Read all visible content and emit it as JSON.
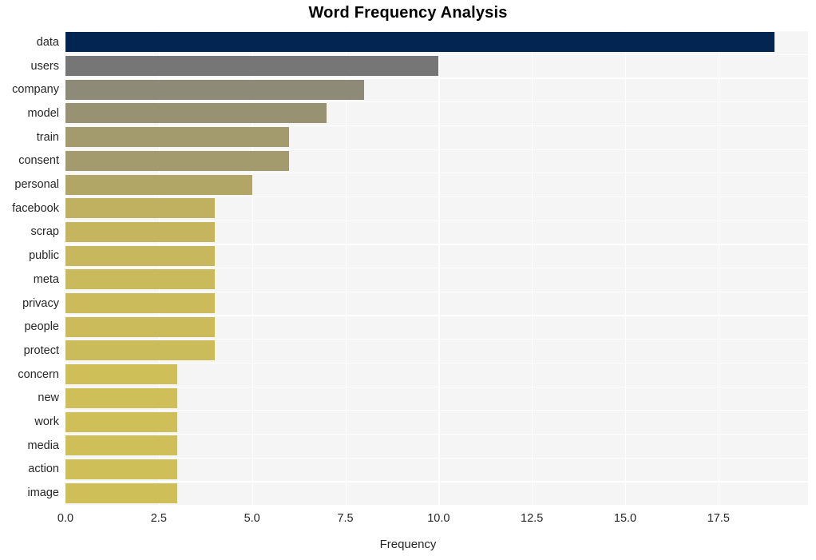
{
  "chart_data": {
    "type": "bar",
    "orientation": "horizontal",
    "title": "Word Frequency Analysis",
    "xlabel": "Frequency",
    "ylabel": "",
    "categories": [
      "data",
      "users",
      "company",
      "model",
      "train",
      "consent",
      "personal",
      "facebook",
      "scrap",
      "public",
      "meta",
      "privacy",
      "people",
      "protect",
      "concern",
      "new",
      "work",
      "media",
      "action",
      "image"
    ],
    "values": [
      19,
      10,
      8,
      7,
      6,
      6,
      5,
      4,
      4,
      4,
      4,
      4,
      4,
      4,
      3,
      3,
      3,
      3,
      3,
      3
    ],
    "xlim": [
      0,
      19.9
    ],
    "xticks": [
      0.0,
      2.5,
      5.0,
      7.5,
      10.0,
      12.5,
      15.0,
      17.5
    ],
    "xtick_labels": [
      "0.0",
      "2.5",
      "5.0",
      "7.5",
      "10.0",
      "12.5",
      "15.0",
      "17.5"
    ],
    "grid": true,
    "grid_color": "#ffffff",
    "legend": null,
    "plot_background": "#f5f5f5",
    "figure_background": "#ffffff",
    "bar_colors": [
      "#032552",
      "#767676",
      "#8d8b78",
      "#999272",
      "#a39a6d",
      "#a39a6d",
      "#b2a667",
      "#bfb160",
      "#c4b55e",
      "#c7b85d",
      "#c9ba5c",
      "#cbbb5b",
      "#cbbb5b",
      "#cbbc5b",
      "#cfbf59",
      "#cfbf59",
      "#cfbf59",
      "#cfbf59",
      "#cfbf59",
      "#cfbf59"
    ]
  }
}
